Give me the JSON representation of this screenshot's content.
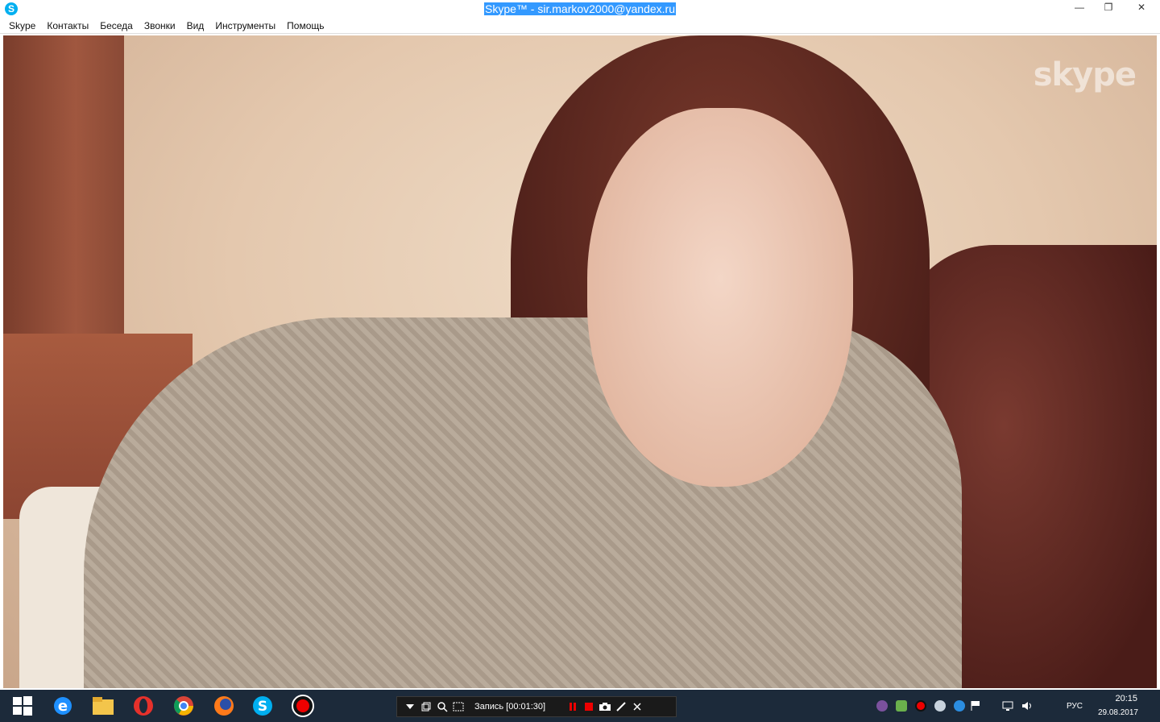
{
  "window": {
    "app_icon_glyph": "S",
    "title_prefix": "Skype™ - ",
    "title_account": "sir.markov2000@yandex.ru",
    "minimize_glyph": "—",
    "restore_glyph": "❐",
    "close_glyph": "✕"
  },
  "menu": {
    "items": [
      "Skype",
      "Контакты",
      "Беседа",
      "Звонки",
      "Вид",
      "Инструменты",
      "Помощь"
    ]
  },
  "video": {
    "watermark": "skype",
    "description_colors": {
      "wall": "#e8cdb4",
      "sweater": "#b6a898",
      "hair": "#5a2a22",
      "couch": "#5a2420"
    }
  },
  "recorder": {
    "status": "Запись [00:01:30]",
    "tools": [
      "dropdown-icon",
      "window-icon",
      "zoom-icon",
      "region-icon"
    ],
    "controls": [
      "pause-icon",
      "stop-icon",
      "camera-icon",
      "pen-icon",
      "close-icon"
    ]
  },
  "taskbar": {
    "apps": [
      "windows-start-icon",
      "internet-explorer-icon",
      "file-explorer-icon",
      "opera-icon",
      "chrome-icon",
      "firefox-icon",
      "skype-icon",
      "recorder-icon"
    ],
    "tray_icons": [
      "viber-icon",
      "chat-icon",
      "record-icon",
      "steam-icon",
      "browser-icon",
      "flag-icon",
      "network-icon",
      "volume-icon"
    ],
    "language": "РУС",
    "time": "20:15",
    "date": "29.08.2017"
  },
  "colors": {
    "skype_blue": "#00aff0",
    "taskbar": "#1c2a3a",
    "title_highlight": "#3399ff"
  }
}
